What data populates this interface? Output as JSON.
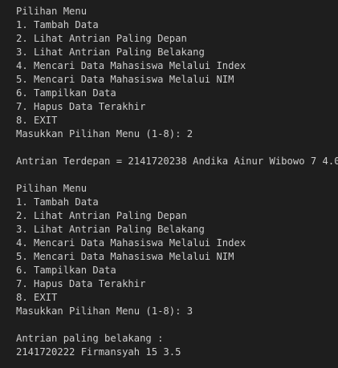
{
  "terminal": {
    "block1": {
      "menu_title": "Pilihan Menu",
      "items": [
        "1. Tambah Data",
        "2. Lihat Antrian Paling Depan",
        "3. Lihat Antrian Paling Belakang",
        "4. Mencari Data Mahasiswa Melalui Index",
        "5. Mencari Data Mahasiswa Melalui NIM",
        "6. Tampilkan Data",
        "7. Hapus Data Terakhir",
        "8. EXIT"
      ],
      "prompt": "Masukkan Pilihan Menu (1-8): 2",
      "result": "Antrian Terdepan = 2141720238 Andika Ainur Wibowo 7 4.0"
    },
    "block2": {
      "menu_title": "Pilihan Menu",
      "items": [
        "1. Tambah Data",
        "2. Lihat Antrian Paling Depan",
        "3. Lihat Antrian Paling Belakang",
        "4. Mencari Data Mahasiswa Melalui Index",
        "5. Mencari Data Mahasiswa Melalui NIM",
        "6. Tampilkan Data",
        "7. Hapus Data Terakhir",
        "8. EXIT"
      ],
      "prompt": "Masukkan Pilihan Menu (1-8): 3",
      "result_label": "Antrian paling belakang :",
      "result_value": "2141720222 Firmansyah 15 3.5"
    }
  }
}
